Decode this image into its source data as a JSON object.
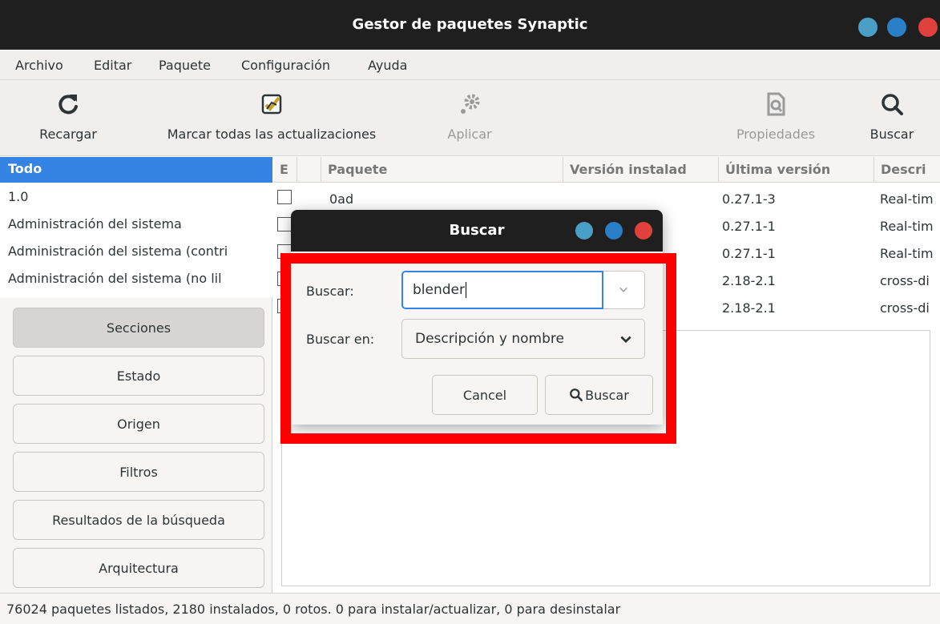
{
  "window": {
    "title": "Gestor de paquetes Synaptic",
    "buttons": {
      "minimize_color": "#4a9fc7",
      "maximize_color": "#2a7fc7",
      "close_color": "#e0413c"
    }
  },
  "menu": [
    "Archivo",
    "Editar",
    "Paquete",
    "Configuración",
    "Ayuda"
  ],
  "toolbar": {
    "reload": "Recargar",
    "mark_all": "Marcar todas las actualizaciones",
    "apply": "Aplicar",
    "properties": "Propiedades",
    "search": "Buscar"
  },
  "filters": [
    "Todo",
    "1.0",
    "Administración del sistema",
    "Administración del sistema (contri",
    "Administración del sistema (no lil"
  ],
  "sidebar_buttons": [
    "Secciones",
    "Estado",
    "Origen",
    "Filtros",
    "Resultados de la búsqueda",
    "Arquitectura"
  ],
  "table": {
    "headers": {
      "status": "E",
      "package": "Paquete",
      "installed": "Versión instalad",
      "latest": "Última versión",
      "description": "Descri"
    },
    "rows": [
      {
        "package": "0ad",
        "latest": "0.27.1-3",
        "description": "Real-tim"
      },
      {
        "package": "",
        "latest": "0.27.1-1",
        "description": "Real-tim"
      },
      {
        "package": "",
        "latest": "0.27.1-1",
        "description": "Real-tim"
      },
      {
        "package": "",
        "latest": "2.18-2.1",
        "description": "cross-di"
      },
      {
        "package": "",
        "latest": "2.18-2.1",
        "description": "cross-di"
      }
    ]
  },
  "status": "76024 paquetes listados, 2180 instalados, 0 rotos. 0 para instalar/actualizar, 0 para desinstalar",
  "dialog": {
    "title": "Buscar",
    "search_label": "Buscar:",
    "search_value": "blender",
    "search_in_label": "Buscar en:",
    "search_in_value": "Descripción y nombre",
    "cancel": "Cancel",
    "search_button": "Buscar"
  },
  "colors": {
    "selection": "#3584e4",
    "highlight_border": "#ff0000"
  }
}
